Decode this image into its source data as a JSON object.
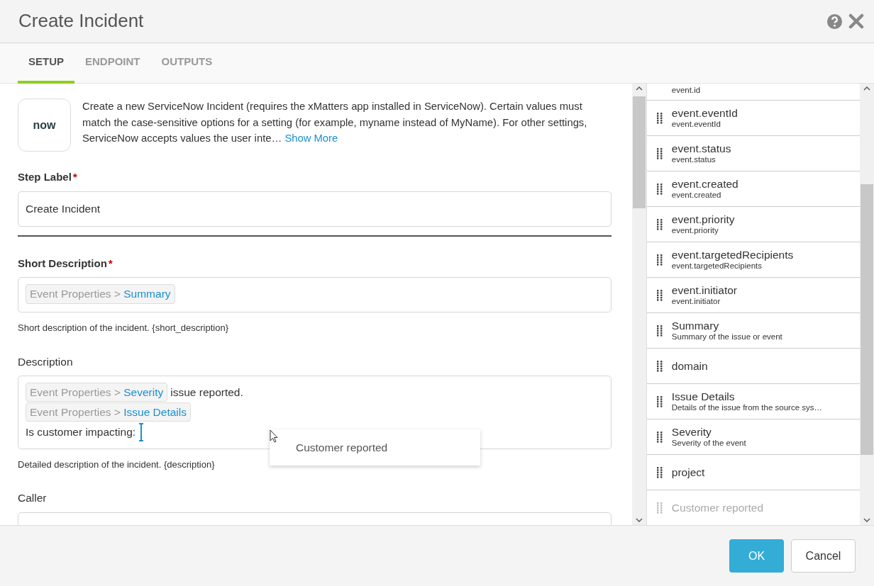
{
  "window": {
    "title": "Create Incident"
  },
  "header_buttons": [
    {
      "kind": "help"
    },
    {
      "kind": "close"
    }
  ],
  "tabs": [
    {
      "label": "SETUP",
      "selected": true
    },
    {
      "label": "ENDPOINT",
      "selected": false
    },
    {
      "label": "OUTPUTS",
      "selected": false
    }
  ],
  "intro": {
    "logo": "now",
    "text": "Create a new ServiceNow Incident (requires the xMatters app installed in ServiceNow). Certain values must match the case-sensitive options for a setting (for example, myname instead of MyName). For other settings, ServiceNow accepts values the user inte…",
    "more_link": "Show More"
  },
  "step_label": {
    "label": "Step Label",
    "required_mark": "*",
    "value": "Create Incident"
  },
  "short_description": {
    "label": "Short Description",
    "required_mark": "*",
    "lines": [
      [
        {
          "kind": "token",
          "path": "Event Properties",
          "separator": ">",
          "name": "Summary"
        }
      ]
    ],
    "help": "Short description of the incident. {short_description}"
  },
  "description": {
    "label": "Description",
    "lines": [
      [
        {
          "kind": "token",
          "path": "Event Properties",
          "separator": ">",
          "name": "Severity"
        },
        {
          "kind": "text",
          "text": "issue reported."
        }
      ],
      [
        {
          "kind": "token",
          "path": "Event Properties",
          "separator": ">",
          "name": "Issue Details"
        }
      ],
      [
        {
          "kind": "text",
          "text": "Is customer impacting:"
        },
        {
          "kind": "caret"
        }
      ]
    ],
    "help": "Detailed description of the incident. {description}"
  },
  "drop_popup": {
    "text": "Customer reported"
  },
  "caller": {
    "label": "Caller"
  },
  "properties": [
    {
      "subtitle": "event.id",
      "dimmed": false
    },
    {
      "title": "event.eventId",
      "subtitle": "event.eventId",
      "dimmed": false
    },
    {
      "title": "event.status",
      "subtitle": "event.status",
      "dimmed": false
    },
    {
      "title": "event.created",
      "subtitle": "event.created",
      "dimmed": false
    },
    {
      "title": "event.priority",
      "subtitle": "event.priority",
      "dimmed": false
    },
    {
      "title": "event.targetedRecipients",
      "subtitle": "event.targetedRecipients",
      "dimmed": false
    },
    {
      "title": "event.initiator",
      "subtitle": "event.initiator",
      "dimmed": false
    },
    {
      "title": "Summary",
      "subtitle": "Summary of the issue or event",
      "dimmed": false
    },
    {
      "title": "domain",
      "dimmed": false
    },
    {
      "title": "Issue Details",
      "subtitle": "Details of the issue from the source sys…",
      "dimmed": false
    },
    {
      "title": "Severity",
      "subtitle": "Severity of the event",
      "dimmed": false
    },
    {
      "title": "project",
      "dimmed": false
    },
    {
      "title": "Customer reported",
      "dimmed": true
    }
  ],
  "footer_buttons": [
    {
      "label": "OK",
      "kind": "primary"
    },
    {
      "label": "Cancel",
      "kind": "secondary"
    }
  ]
}
